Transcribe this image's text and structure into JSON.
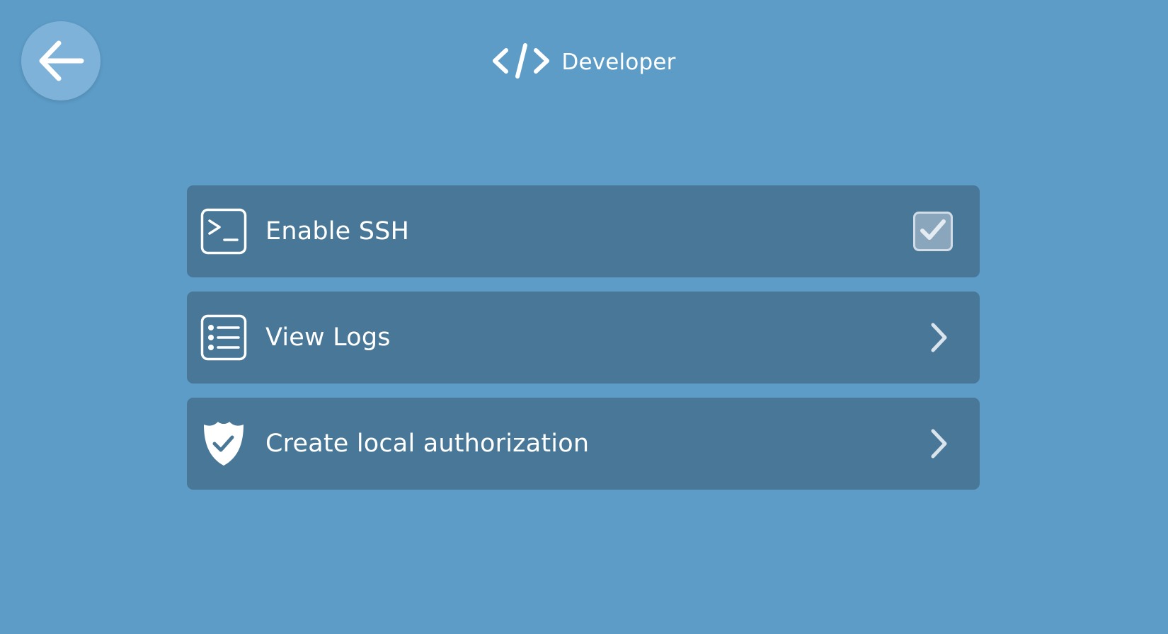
{
  "header": {
    "title": "Developer",
    "icon": "code-icon"
  },
  "back": {
    "icon": "arrow-left-icon"
  },
  "menu": {
    "items": [
      {
        "label": "Enable SSH",
        "icon": "terminal-icon",
        "control": "checkbox",
        "checked": true
      },
      {
        "label": "View Logs",
        "icon": "list-icon",
        "control": "chevron"
      },
      {
        "label": "Create local authorization",
        "icon": "shield-check-icon",
        "control": "chevron"
      }
    ]
  },
  "colors": {
    "background": "#5c9cc7",
    "item_background": "#497797",
    "back_button": "#7fb2d8",
    "text": "#ffffff"
  }
}
